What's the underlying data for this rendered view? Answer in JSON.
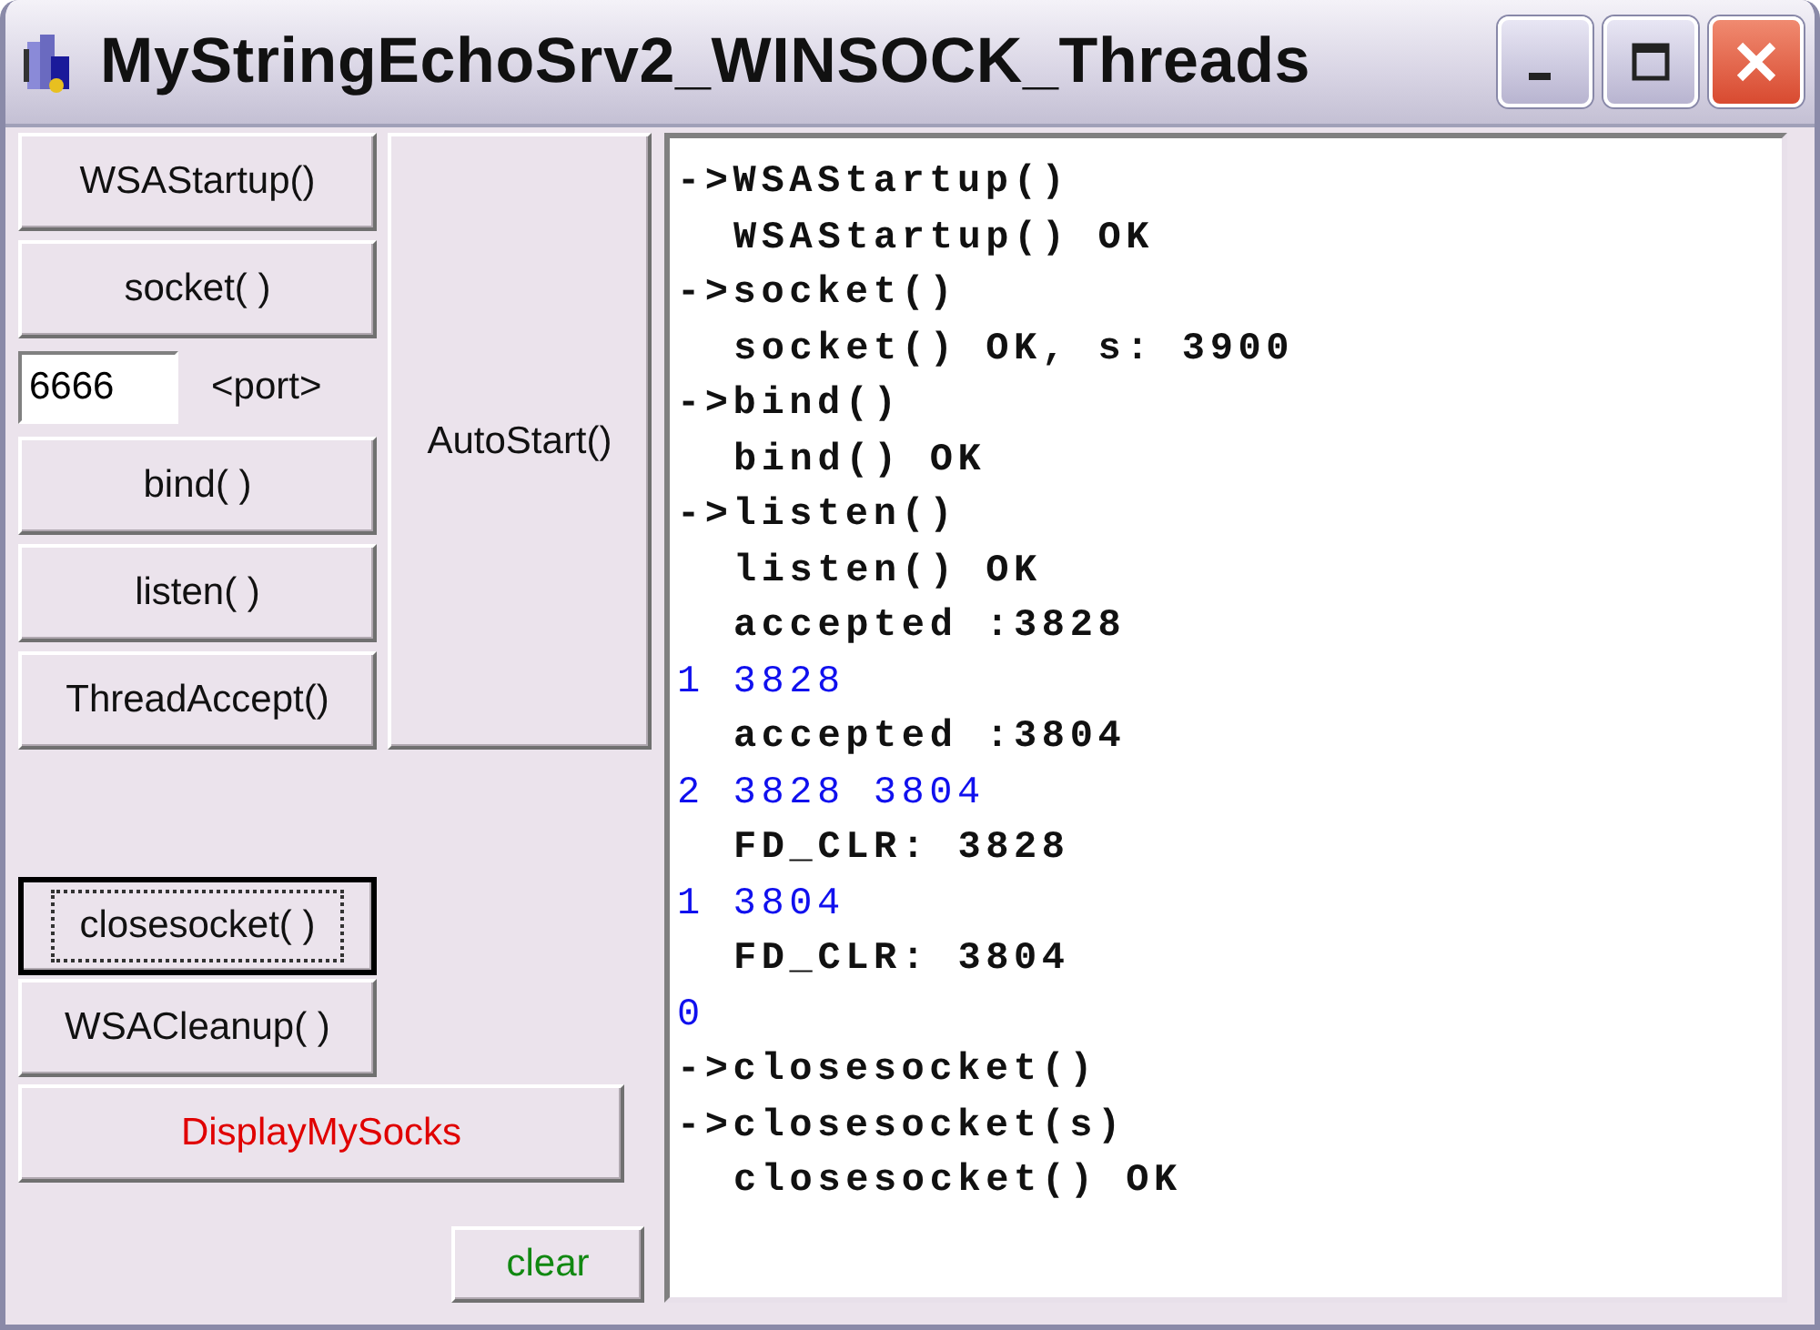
{
  "window": {
    "title": "MyStringEchoSrv2_WINSOCK_Threads"
  },
  "buttons_top": [
    {
      "label": "WSAStartup()"
    },
    {
      "label": "socket( )"
    }
  ],
  "port": {
    "value": "6666",
    "label": "<port>"
  },
  "buttons_mid": [
    {
      "label": "bind( )"
    },
    {
      "label": "listen( )"
    },
    {
      "label": "ThreadAccept()"
    }
  ],
  "autostart_button": {
    "label": "AutoStart()"
  },
  "buttons_bottom": [
    {
      "label": "closesocket( )",
      "focused": true
    },
    {
      "label": "WSACleanup( )",
      "focused": false
    }
  ],
  "display_button": {
    "label": "DisplayMySocks"
  },
  "clear_button": {
    "label": "clear"
  },
  "log": {
    "lines": [
      {
        "text": "->WSAStartup()",
        "kind": "call"
      },
      {
        "text": "WSAStartup() OK",
        "kind": "result"
      },
      {
        "text": "->socket()",
        "kind": "call"
      },
      {
        "text": "socket() OK, s: 3900",
        "kind": "result"
      },
      {
        "text": "->bind()",
        "kind": "call"
      },
      {
        "text": "bind() OK",
        "kind": "result"
      },
      {
        "text": "->listen()",
        "kind": "call"
      },
      {
        "text": "listen() OK",
        "kind": "result"
      },
      {
        "text": "accepted :3828",
        "kind": "result"
      },
      {
        "text": "1 3828",
        "kind": "count"
      },
      {
        "text": "accepted :3804",
        "kind": "result"
      },
      {
        "text": "2 3828 3804",
        "kind": "count"
      },
      {
        "text": "FD_CLR: 3828",
        "kind": "result"
      },
      {
        "text": "1 3804",
        "kind": "count"
      },
      {
        "text": "FD_CLR: 3804",
        "kind": "result"
      },
      {
        "text": "0",
        "kind": "count"
      },
      {
        "text": "->closesocket()",
        "kind": "call"
      },
      {
        "text": "->closesocket(s)",
        "kind": "call"
      },
      {
        "text": "closesocket() OK",
        "kind": "result"
      }
    ]
  }
}
